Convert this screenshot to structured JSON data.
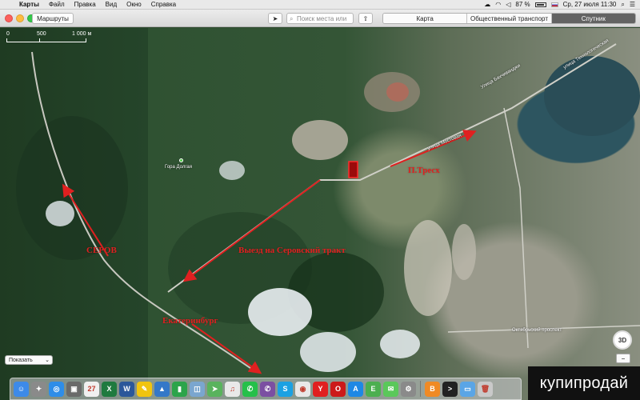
{
  "menubar": {
    "app_name": "Карты",
    "items": [
      "Файл",
      "Правка",
      "Вид",
      "Окно",
      "Справка"
    ],
    "battery": "87 %",
    "datetime": "Ср, 27 июля  11:30"
  },
  "toolbar": {
    "routes_label": "Маршруты",
    "search_placeholder": "Поиск места или",
    "map_types": [
      "Карта",
      "Общественный транспорт",
      "Спутник"
    ],
    "active_map_type": "Спутник"
  },
  "map": {
    "scale": [
      "0",
      "500",
      "1 000 м"
    ],
    "poi_label": "Гора Долгая",
    "street_labels": [
      "улица Мостовая",
      "Улица Бахчиванджи",
      "улица Технологическая",
      "Октябрьский проспект"
    ],
    "annotations": {
      "tireshk": "П.Тресх",
      "vyezd": "Выезд на Серовский тракт",
      "serov": "СЕРОВ",
      "ekb": "Екатеринбург"
    },
    "show_label": "Показать",
    "button_3d": "3D",
    "zoom_label": "−"
  },
  "dock": {
    "apps": [
      {
        "icon": "finder-icon",
        "color": "#3d8ae8",
        "glyph": "☺"
      },
      {
        "icon": "launchpad-icon",
        "color": "#8a8a8a",
        "glyph": "✦"
      },
      {
        "icon": "safari-icon",
        "color": "#2e8de8",
        "glyph": "◎"
      },
      {
        "icon": "photos-icon",
        "color": "#6a6a6a",
        "glyph": "▣"
      },
      {
        "icon": "calendar-icon",
        "color": "#f0f0f0",
        "glyph": "27"
      },
      {
        "icon": "excel-icon",
        "color": "#1f7a3f",
        "glyph": "X"
      },
      {
        "icon": "word-icon",
        "color": "#2b579a",
        "glyph": "W"
      },
      {
        "icon": "notes-icon",
        "color": "#f1c40f",
        "glyph": "✎"
      },
      {
        "icon": "keynote-icon",
        "color": "#3478c8",
        "glyph": "▲"
      },
      {
        "icon": "numbers-icon",
        "color": "#2ca44a",
        "glyph": "▮"
      },
      {
        "icon": "preview-icon",
        "color": "#7aa6cf",
        "glyph": "◫"
      },
      {
        "icon": "maps-icon",
        "color": "#59b35d",
        "glyph": "➤"
      },
      {
        "icon": "music-icon",
        "color": "#e9e9e9",
        "glyph": "♫"
      },
      {
        "icon": "whatsapp-icon",
        "color": "#25c04a",
        "glyph": "✆"
      },
      {
        "icon": "viber-icon",
        "color": "#7b4fa2",
        "glyph": "✆"
      },
      {
        "icon": "skype-icon",
        "color": "#1ba1e2",
        "glyph": "S"
      },
      {
        "icon": "chrome-icon",
        "color": "#e8e8e8",
        "glyph": "◉"
      },
      {
        "icon": "yandex-icon",
        "color": "#e02020",
        "glyph": "Y"
      },
      {
        "icon": "opera-icon",
        "color": "#cc1a1a",
        "glyph": "O"
      },
      {
        "icon": "appstore-icon",
        "color": "#1e88e5",
        "glyph": "A"
      },
      {
        "icon": "evernote-icon",
        "color": "#4caf50",
        "glyph": "E"
      },
      {
        "icon": "messages-icon",
        "color": "#5ac85a",
        "glyph": "✉"
      },
      {
        "icon": "system-prefs-icon",
        "color": "#8a8a8a",
        "glyph": "⚙"
      },
      {
        "icon": "books-icon",
        "color": "#f08a24",
        "glyph": "B"
      },
      {
        "icon": "terminal-icon",
        "color": "#222222",
        "glyph": ">"
      },
      {
        "icon": "folder-icon",
        "color": "#5aa5e6",
        "glyph": "▭"
      },
      {
        "icon": "trash-icon",
        "color": "#c9c9c9",
        "glyph": "🗑"
      }
    ]
  },
  "watermark": "купипродай"
}
